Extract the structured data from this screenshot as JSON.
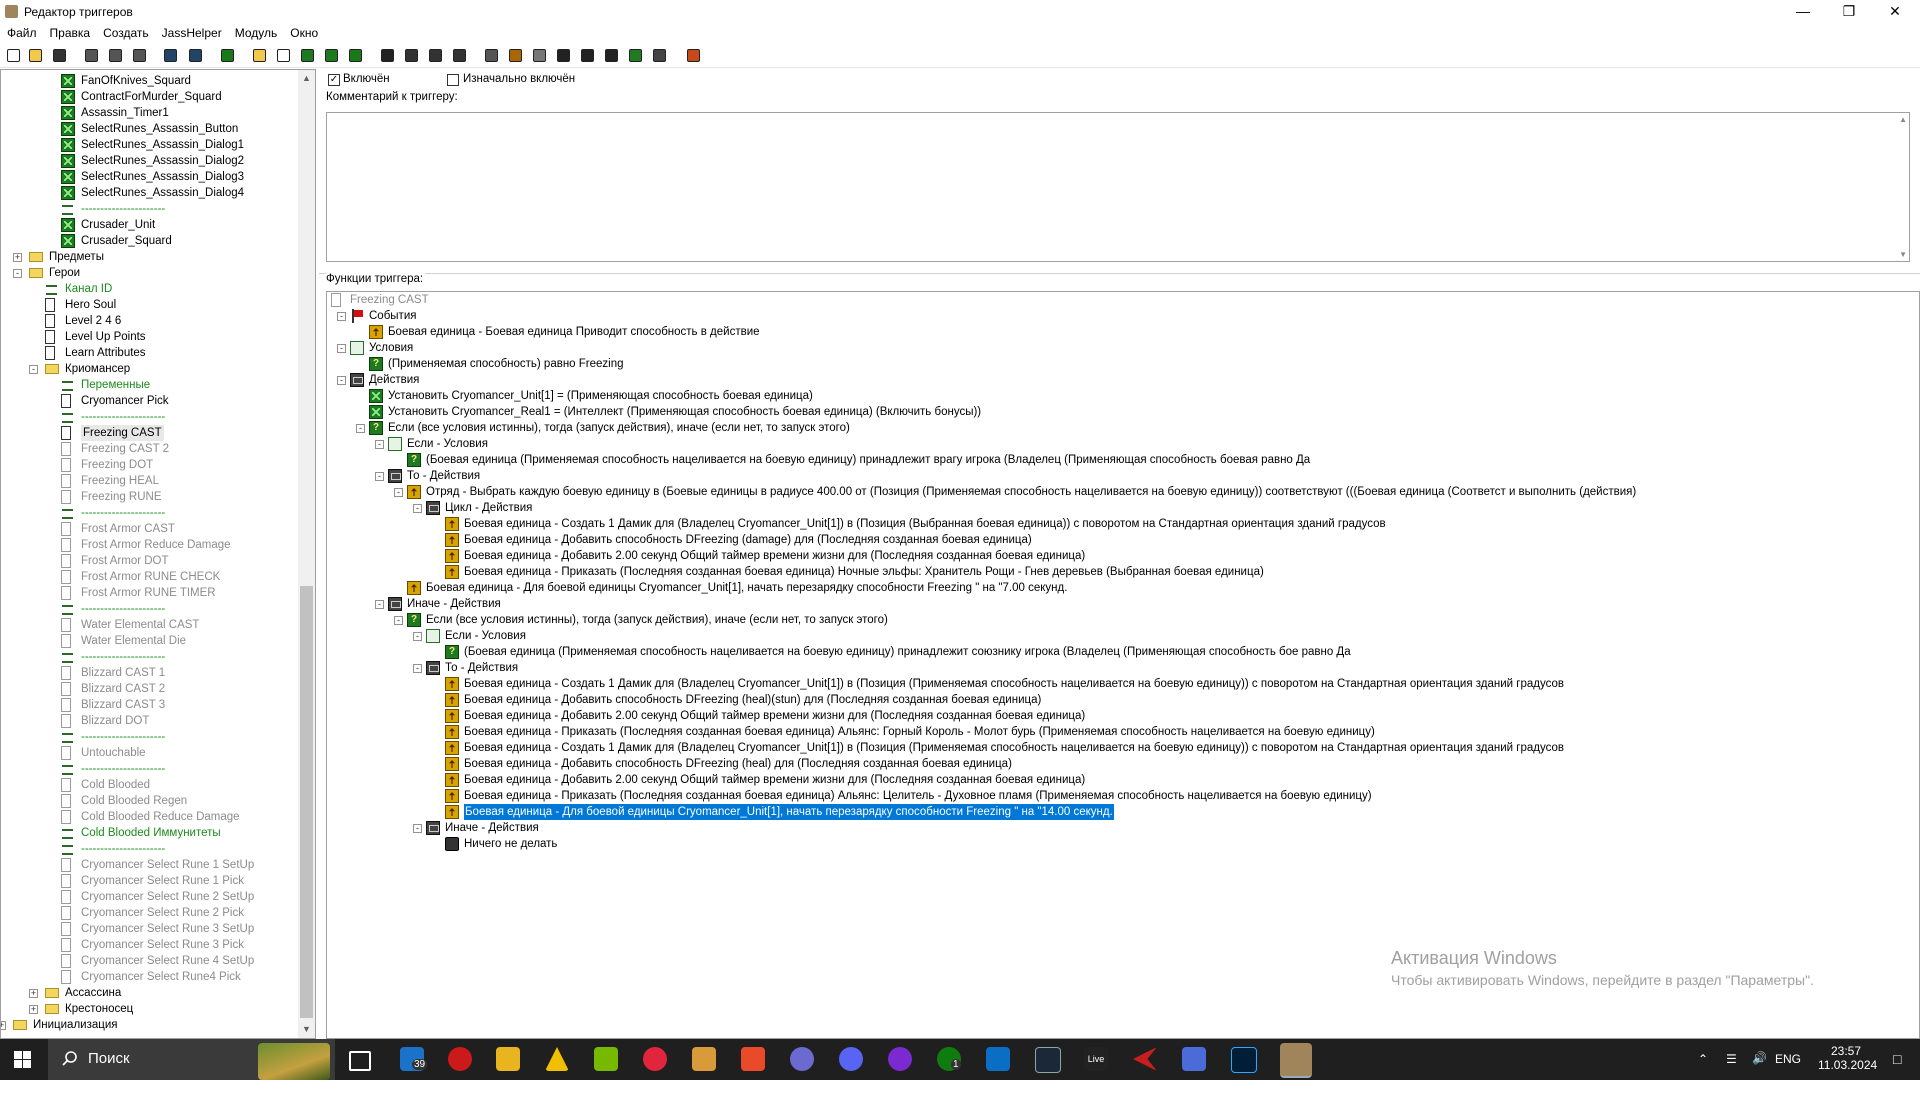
{
  "window": {
    "title": "Редактор триггеров"
  },
  "menu": [
    "Файл",
    "Правка",
    "Создать",
    "JassHelper",
    "Модуль",
    "Окно"
  ],
  "left_tree": [
    {
      "indent": 3,
      "icon": "var",
      "label": "FanOfKnives_Squard",
      "style": ""
    },
    {
      "indent": 3,
      "icon": "var",
      "label": "ContractForMurder_Squard",
      "style": ""
    },
    {
      "indent": 3,
      "icon": "var",
      "label": "Assassin_Timer1",
      "style": ""
    },
    {
      "indent": 3,
      "icon": "var",
      "label": "SelectRunes_Assassin_Button",
      "style": ""
    },
    {
      "indent": 3,
      "icon": "var",
      "label": "SelectRunes_Assassin_Dialog1",
      "style": ""
    },
    {
      "indent": 3,
      "icon": "var",
      "label": "SelectRunes_Assassin_Dialog2",
      "style": ""
    },
    {
      "indent": 3,
      "icon": "var",
      "label": "SelectRunes_Assassin_Dialog3",
      "style": ""
    },
    {
      "indent": 3,
      "icon": "var",
      "label": "SelectRunes_Assassin_Dialog4",
      "style": ""
    },
    {
      "indent": 3,
      "icon": "cmt",
      "label": "----------------------",
      "style": "grn"
    },
    {
      "indent": 3,
      "icon": "var",
      "label": "Crusader_Unit",
      "style": ""
    },
    {
      "indent": 3,
      "icon": "var",
      "label": "Crusader_Squard",
      "style": ""
    },
    {
      "indent": 1,
      "icon": "folder",
      "label": "Предметы",
      "style": "",
      "exp": "+"
    },
    {
      "indent": 1,
      "icon": "folder",
      "label": "Герои",
      "style": "",
      "exp": "-"
    },
    {
      "indent": 2,
      "icon": "cmt",
      "label": "Канал ID",
      "style": "grn"
    },
    {
      "indent": 2,
      "icon": "doc",
      "label": "Hero Soul",
      "style": ""
    },
    {
      "indent": 2,
      "icon": "doc",
      "label": "Level 2 4 6",
      "style": ""
    },
    {
      "indent": 2,
      "icon": "doc",
      "label": "Level Up Points",
      "style": ""
    },
    {
      "indent": 2,
      "icon": "doc",
      "label": "Learn Attributes",
      "style": ""
    },
    {
      "indent": 2,
      "icon": "folder",
      "label": "Криомансер",
      "style": "",
      "exp": "-"
    },
    {
      "indent": 3,
      "icon": "cmt",
      "label": "Переменные",
      "style": "grn"
    },
    {
      "indent": 3,
      "icon": "doc",
      "label": "Cryomancer Pick",
      "style": ""
    },
    {
      "indent": 3,
      "icon": "cmt",
      "label": "----------------------",
      "style": "grn"
    },
    {
      "indent": 3,
      "icon": "doc",
      "label": "Freezing CAST",
      "style": "",
      "selected": true
    },
    {
      "indent": 3,
      "icon": "docg",
      "label": "Freezing CAST 2",
      "style": "dis"
    },
    {
      "indent": 3,
      "icon": "docg",
      "label": "Freezing DOT",
      "style": "dis"
    },
    {
      "indent": 3,
      "icon": "docg",
      "label": "Freezing HEAL",
      "style": "dis"
    },
    {
      "indent": 3,
      "icon": "docg",
      "label": "Freezing RUNE",
      "style": "dis"
    },
    {
      "indent": 3,
      "icon": "cmt",
      "label": "----------------------",
      "style": "grn"
    },
    {
      "indent": 3,
      "icon": "docg",
      "label": "Frost Armor CAST",
      "style": "dis"
    },
    {
      "indent": 3,
      "icon": "docg",
      "label": "Frost Armor Reduce Damage",
      "style": "dis"
    },
    {
      "indent": 3,
      "icon": "docg",
      "label": "Frost Armor DOT",
      "style": "dis"
    },
    {
      "indent": 3,
      "icon": "docg",
      "label": "Frost Armor RUNE CHECK",
      "style": "dis"
    },
    {
      "indent": 3,
      "icon": "docg",
      "label": "Frost Armor RUNE TIMER",
      "style": "dis"
    },
    {
      "indent": 3,
      "icon": "cmt",
      "label": "----------------------",
      "style": "grn"
    },
    {
      "indent": 3,
      "icon": "docg",
      "label": "Water Elemental CAST",
      "style": "dis"
    },
    {
      "indent": 3,
      "icon": "docg",
      "label": "Water Elemental Die",
      "style": "dis"
    },
    {
      "indent": 3,
      "icon": "cmt",
      "label": "----------------------",
      "style": "grn"
    },
    {
      "indent": 3,
      "icon": "docg",
      "label": "Blizzard CAST 1",
      "style": "dis"
    },
    {
      "indent": 3,
      "icon": "docg",
      "label": "Blizzard CAST 2",
      "style": "dis"
    },
    {
      "indent": 3,
      "icon": "docg",
      "label": "Blizzard CAST 3",
      "style": "dis"
    },
    {
      "indent": 3,
      "icon": "docg",
      "label": "Blizzard DOT",
      "style": "dis"
    },
    {
      "indent": 3,
      "icon": "cmt",
      "label": "----------------------",
      "style": "grn"
    },
    {
      "indent": 3,
      "icon": "docg",
      "label": "Untouchable",
      "style": "dis"
    },
    {
      "indent": 3,
      "icon": "cmt",
      "label": "----------------------",
      "style": "grn"
    },
    {
      "indent": 3,
      "icon": "docg",
      "label": "Cold Blooded",
      "style": "dis"
    },
    {
      "indent": 3,
      "icon": "docg",
      "label": "Cold Blooded Regen",
      "style": "dis"
    },
    {
      "indent": 3,
      "icon": "docg",
      "label": "Cold Blooded Reduce Damage",
      "style": "dis"
    },
    {
      "indent": 3,
      "icon": "cmt",
      "label": "Cold Blooded Иммунитеты",
      "style": "grn"
    },
    {
      "indent": 3,
      "icon": "cmt",
      "label": "----------------------",
      "style": "grn"
    },
    {
      "indent": 3,
      "icon": "docg",
      "label": "Cryomancer Select Rune 1 SetUp",
      "style": "dis"
    },
    {
      "indent": 3,
      "icon": "docg",
      "label": "Cryomancer Select Rune 1 Pick",
      "style": "dis"
    },
    {
      "indent": 3,
      "icon": "docg",
      "label": "Cryomancer Select Rune 2 SetUp",
      "style": "dis"
    },
    {
      "indent": 3,
      "icon": "docg",
      "label": "Cryomancer Select Rune 2 Pick",
      "style": "dis"
    },
    {
      "indent": 3,
      "icon": "docg",
      "label": "Cryomancer Select Rune 3 SetUp",
      "style": "dis"
    },
    {
      "indent": 3,
      "icon": "docg",
      "label": "Cryomancer Select Rune 3 Pick",
      "style": "dis"
    },
    {
      "indent": 3,
      "icon": "docg",
      "label": "Cryomancer Select Rune 4 SetUp",
      "style": "dis"
    },
    {
      "indent": 3,
      "icon": "docg",
      "label": "Cryomancer Select Rune4 Pick",
      "style": "dis"
    },
    {
      "indent": 2,
      "icon": "folder",
      "label": "Ассассина",
      "style": "",
      "exp": "+"
    },
    {
      "indent": 2,
      "icon": "folder",
      "label": "Крестоносец",
      "style": "",
      "exp": "+"
    },
    {
      "indent": 0,
      "icon": "folder",
      "label": "Инициализация",
      "style": "",
      "exp": "+"
    }
  ],
  "trigger": {
    "enabled_label": "Включён",
    "initially_on_label": "Изначально включён",
    "comment_label": "Комментарий к триггеру:",
    "functions_label": "Функции триггера:"
  },
  "functions": [
    {
      "indent": 0,
      "icon": "docg",
      "label": "Freezing CAST",
      "style": "dis"
    },
    {
      "indent": 1,
      "icon": "flag",
      "label": "События",
      "exp": "-"
    },
    {
      "indent": 2,
      "icon": "act",
      "label": "Боевая единица - Боевая единица Приводит способность в действие"
    },
    {
      "indent": 1,
      "icon": "condgrp",
      "label": "Условия",
      "exp": "-"
    },
    {
      "indent": 2,
      "icon": "cond",
      "label": "(Применяемая способность) равно Freezing"
    },
    {
      "indent": 1,
      "icon": "actgrp",
      "label": "Действия",
      "exp": "-"
    },
    {
      "indent": 2,
      "icon": "var",
      "label": "Установить Cryomancer_Unit[1] = (Применяющая способность боевая единица)"
    },
    {
      "indent": 2,
      "icon": "var",
      "label": "Установить Cryomancer_Real1 = (Интеллект (Применяющая способность боевая единица) (Включить бонусы))"
    },
    {
      "indent": 2,
      "icon": "cond",
      "label": "Если (все условия истинны), тогда (запуск действия), иначе (если нет, то запуск этого)",
      "exp": "-"
    },
    {
      "indent": 3,
      "icon": "condgrp",
      "label": "Если - Условия",
      "exp": "-"
    },
    {
      "indent": 4,
      "icon": "cond",
      "label": "(Боевая единица (Применяемая способность нацеливается на боевую единицу) принадлежит врагу игрока (Владелец (Применяющая способность боевая равно Да"
    },
    {
      "indent": 3,
      "icon": "actgrp",
      "label": "То - Действия",
      "exp": "-"
    },
    {
      "indent": 4,
      "icon": "act",
      "label": "Отряд - Выбрать каждую боевую единицу в (Боевые единицы в радиусе 400.00 от (Позиция (Применяемая способность нацеливается на боевую единицу)) соответствуют (((Боевая единица (Соответст и выполнить (действия)",
      "exp": "-"
    },
    {
      "indent": 5,
      "icon": "actgrp",
      "label": "Цикл - Действия",
      "exp": "-"
    },
    {
      "indent": 6,
      "icon": "act",
      "label": "Боевая единица - Создать 1 Дамик для (Владелец Cryomancer_Unit[1]) в (Позиция (Выбранная боевая единица)) с поворотом на Стандартная ориентация зданий градусов"
    },
    {
      "indent": 6,
      "icon": "act",
      "label": "Боевая единица - Добавить способность DFreezing (damage) для (Последняя созданная боевая единица)"
    },
    {
      "indent": 6,
      "icon": "act",
      "label": "Боевая единица - Добавить 2.00 секунд Общий таймер времени жизни для (Последняя созданная боевая единица)"
    },
    {
      "indent": 6,
      "icon": "act",
      "label": "Боевая единица - Приказать (Последняя созданная боевая единица) Ночные эльфы: Хранитель Рощи - Гнев деревьев (Выбранная боевая единица)"
    },
    {
      "indent": 4,
      "icon": "act",
      "label": "Боевая единица - Для боевой единицы Cryomancer_Unit[1], начать перезарядку способности Freezing  \" на \"7.00 секунд."
    },
    {
      "indent": 3,
      "icon": "actgrp",
      "label": "Иначе - Действия",
      "exp": "-"
    },
    {
      "indent": 4,
      "icon": "cond",
      "label": "Если (все условия истинны), тогда (запуск действия), иначе (если нет, то запуск этого)",
      "exp": "-"
    },
    {
      "indent": 5,
      "icon": "condgrp",
      "label": "Если - Условия",
      "exp": "-"
    },
    {
      "indent": 6,
      "icon": "cond",
      "label": "(Боевая единица (Применяемая способность нацеливается на боевую единицу) принадлежит союзнику игрока (Владелец (Применяющая способность бое равно Да"
    },
    {
      "indent": 5,
      "icon": "actgrp",
      "label": "То - Действия",
      "exp": "-"
    },
    {
      "indent": 6,
      "icon": "act",
      "label": "Боевая единица - Создать 1 Дамик для (Владелец Cryomancer_Unit[1]) в (Позиция (Применяемая способность нацеливается на боевую единицу)) с поворотом на Стандартная ориентация зданий градусов"
    },
    {
      "indent": 6,
      "icon": "act",
      "label": "Боевая единица - Добавить способность DFreezing (heal)(stun) для (Последняя созданная боевая единица)"
    },
    {
      "indent": 6,
      "icon": "act",
      "label": "Боевая единица - Добавить 2.00 секунд Общий таймер времени жизни для (Последняя созданная боевая единица)"
    },
    {
      "indent": 6,
      "icon": "act",
      "label": "Боевая единица - Приказать (Последняя созданная боевая единица) Альянс: Горный Король - Молот бурь (Применяемая способность нацеливается на боевую единицу)"
    },
    {
      "indent": 6,
      "icon": "act",
      "label": "Боевая единица - Создать 1 Дамик для (Владелец Cryomancer_Unit[1]) в (Позиция (Применяемая способность нацеливается на боевую единицу)) с поворотом на Стандартная ориентация зданий градусов"
    },
    {
      "indent": 6,
      "icon": "act",
      "label": "Боевая единица - Добавить способность DFreezing (heal) для (Последняя созданная боевая единица)"
    },
    {
      "indent": 6,
      "icon": "act",
      "label": "Боевая единица - Добавить 2.00 секунд Общий таймер времени жизни для (Последняя созданная боевая единица)"
    },
    {
      "indent": 6,
      "icon": "act",
      "label": "Боевая единица - Приказать (Последняя созданная боевая единица) Альянс: Целитель - Духовное пламя (Применяемая способность нацеливается на боевую единицу)"
    },
    {
      "indent": 6,
      "icon": "act",
      "label": "Боевая единица - Для боевой единицы Cryomancer_Unit[1], начать перезарядку способности Freezing  \" на \"14.00 секунд.",
      "selected": true
    },
    {
      "indent": 5,
      "icon": "actgrp",
      "label": "Иначе - Действия",
      "exp": "-"
    },
    {
      "indent": 6,
      "icon": "nothing",
      "label": "Ничего не делать"
    }
  ],
  "watermark": {
    "line1": "Активация Windows",
    "line2": "Чтобы активировать Windows, перейдите в раздел \"Параметры\"."
  },
  "taskbar": {
    "search_placeholder": "Поиск",
    "mail_badge": "39",
    "xbox_badge": "1",
    "lang": "ENG",
    "time": "23:57",
    "date": "11.03.2024"
  }
}
